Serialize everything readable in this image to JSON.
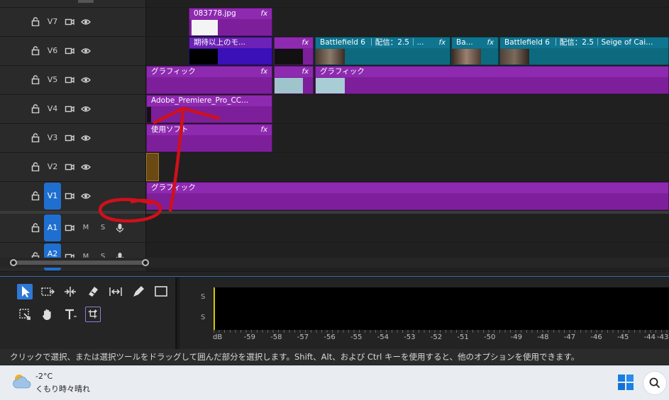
{
  "tracks": {
    "V7": "V7",
    "V6": "V6",
    "V5": "V5",
    "V4": "V4",
    "V3": "V3",
    "V2": "V2",
    "V1": "V1",
    "A1": "A1",
    "A2": "A2",
    "mute": "M",
    "solo": "S"
  },
  "clips": {
    "v7_1": "083778.jpg",
    "v6_1": "期待以上のモ...",
    "v6_3": "Battlefield 6 ｜配信：2.5｜...",
    "v6_4": "Ba...",
    "v6_5": "Battlefield 6 ｜配信：2.5｜Seige of Cairo ...",
    "v5_1": "グラフィック",
    "v5_3": "グラフィック",
    "v4_1": "Adobe_Premiere_Pro_CC...",
    "v3_1": "使用ソフト",
    "v1_1": "グラフィック",
    "fx": "fx"
  },
  "meter": {
    "s1": "S",
    "s2": "S",
    "ticks": [
      "dB",
      "-59",
      "-58",
      "-57",
      "-56",
      "-55",
      "-54",
      "-53",
      "-52",
      "-51",
      "-50",
      "-49",
      "-48",
      "-47",
      "-46",
      "-45",
      "-44",
      "-43"
    ]
  },
  "status": {
    "text": "クリックで選択、または選択ツールをドラッグして囲んだ部分を選択します。Shift、Alt、および Ctrl キーを使用すると、他のオプションを使用できます。"
  },
  "taskbar": {
    "temperature": "-2°C",
    "weather": "くもり時々晴れ"
  },
  "colors": {
    "active_track": "#1f6fd1",
    "graphic_clip": "#7d1f9a",
    "video_clip": "#0d6a7e",
    "annotation": "#d0101a"
  }
}
